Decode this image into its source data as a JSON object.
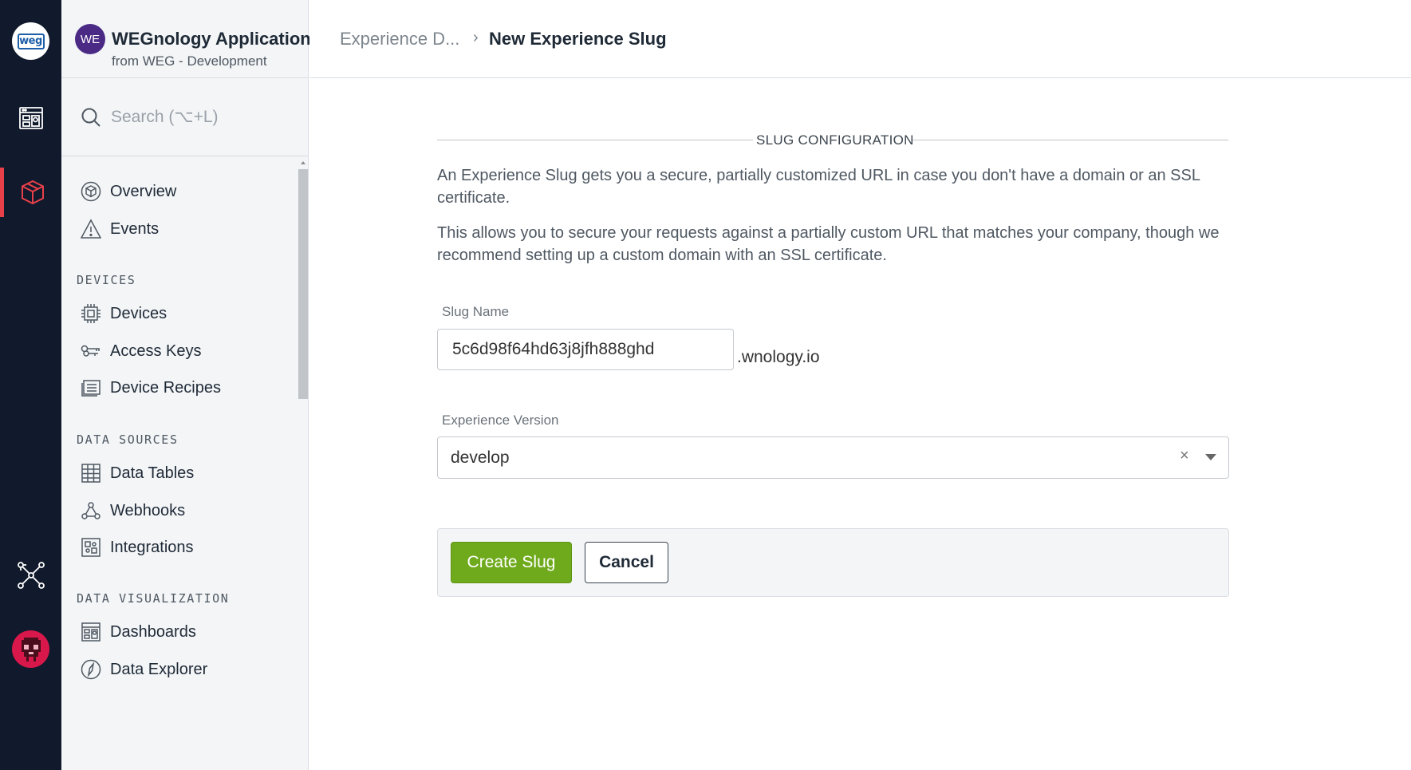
{
  "app": {
    "badge": "WE",
    "name": "WEGnology Application",
    "subtitle": "from WEG - Development"
  },
  "rail": {
    "logo_text": "weg"
  },
  "search": {
    "placeholder": "Search (⌥+L)"
  },
  "nav": {
    "items_top": [
      {
        "label": "Overview",
        "icon": "cube-outline-icon"
      },
      {
        "label": "Events",
        "icon": "warning-triangle-icon"
      }
    ],
    "devices": {
      "title": "DEVICES",
      "items": [
        {
          "label": "Devices",
          "icon": "chip-icon"
        },
        {
          "label": "Access Keys",
          "icon": "keys-icon"
        },
        {
          "label": "Device Recipes",
          "icon": "recipe-icon"
        }
      ]
    },
    "data_sources": {
      "title": "DATA SOURCES",
      "items": [
        {
          "label": "Data Tables",
          "icon": "table-grid-icon"
        },
        {
          "label": "Webhooks",
          "icon": "webhook-icon"
        },
        {
          "label": "Integrations",
          "icon": "puzzle-icon"
        }
      ]
    },
    "data_visualization": {
      "title": "DATA VISUALIZATION",
      "items": [
        {
          "label": "Dashboards",
          "icon": "dashboard-icon"
        },
        {
          "label": "Data Explorer",
          "icon": "compass-icon"
        }
      ]
    }
  },
  "breadcrumb": {
    "parent": "Experience D...",
    "separator": "›",
    "current": "New Experience Slug"
  },
  "form": {
    "section_title": "SLUG CONFIGURATION",
    "paragraph_1": "An Experience Slug gets you a secure, partially customized URL in case you don't have a domain or an SSL certificate.",
    "paragraph_2": "This allows you to secure your requests against a partially custom URL that matches your company, though we recommend setting up a custom domain with an SSL certificate.",
    "slug_label": "Slug Name",
    "slug_value": "5c6d98f64hd63j8jfh888ghd",
    "slug_suffix": ".wnology.io",
    "version_label": "Experience Version",
    "version_value": "develop",
    "clear_symbol": "×",
    "create_label": "Create Slug",
    "cancel_label": "Cancel"
  },
  "colors": {
    "rail_bg": "#101a2c",
    "rail_active": "#e8404a",
    "primary_button": "#6faa1c",
    "app_badge": "#4b2a86",
    "avatar": "#d8174a"
  }
}
